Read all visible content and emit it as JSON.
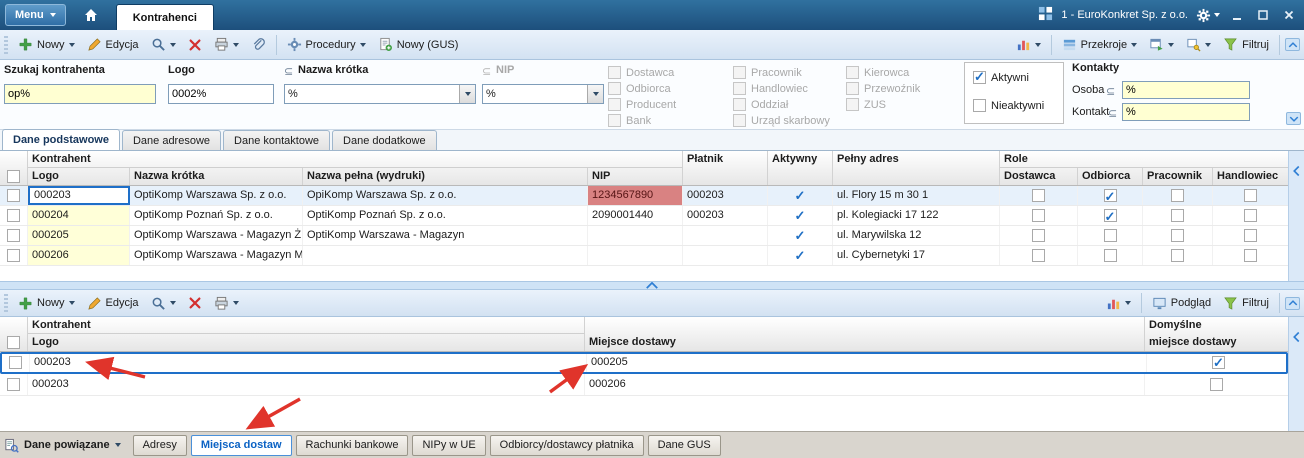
{
  "titlebar": {
    "menu": "Menu",
    "tab": "Kontrahenci",
    "company": "1 - EuroKonkret Sp. z o.o."
  },
  "toolbar1": {
    "nowy": "Nowy",
    "edycja": "Edycja",
    "procedury": "Procedury",
    "nowy_gus": "Nowy (GUS)",
    "przekroje": "Przekroje",
    "filtruj": "Filtruj"
  },
  "filters": {
    "szukaj": {
      "label": "Szukaj kontrahenta",
      "value": "op%"
    },
    "logo": {
      "label": "Logo",
      "value": "0002%"
    },
    "nazwa_krotka": {
      "label": "Nazwa krótka",
      "op": "⊆",
      "value": "%"
    },
    "nip": {
      "label": "NIP",
      "op": "⊆",
      "value": "%"
    },
    "role_group1": [
      "Dostawca",
      "Odbiorca",
      "Producent",
      "Bank"
    ],
    "role_group2": [
      "Pracownik",
      "Handlowiec",
      "Oddział",
      "Urząd skarbowy"
    ],
    "role_group3": [
      "Kierowca",
      "Przewoźnik",
      "ZUS"
    ],
    "aktywni": "Aktywni",
    "aktywni_checked": true,
    "nieaktywni": "Nieaktywni",
    "nieaktywni_checked": false,
    "kontakty": {
      "label": "Kontakty",
      "osoba_label": "Osoba",
      "osoba_op": "⊆",
      "osoba_value": "%",
      "kontakt_label": "Kontakt",
      "kontakt_op": "⊆",
      "kontakt_value": "%"
    }
  },
  "tabs": [
    "Dane podstawowe",
    "Dane adresowe",
    "Dane kontaktowe",
    "Dane dodatkowe"
  ],
  "grid1": {
    "groups": {
      "kontrahent": "Kontrahent",
      "role": "Role"
    },
    "headers": {
      "logo": "Logo",
      "nazwa_krotka": "Nazwa krótka",
      "nazwa_pelna": "Nazwa pełna (wydruki)",
      "nip": "NIP",
      "platnik": "Płatnik",
      "aktywny": "Aktywny",
      "pelny_adres": "Pełny adres",
      "dostawca": "Dostawca",
      "odbiorca": "Odbiorca",
      "pracownik": "Pracownik",
      "handlowiec": "Handlowiec"
    },
    "rows": [
      {
        "logo": "000203",
        "nazwa_krotka": "OptiKomp Warszawa Sp. z o.o.",
        "nazwa_pelna": "OpiKomp Warszawa Sp. z o.o.",
        "nip": "1234567890",
        "nip_invalid": true,
        "platnik": "000203",
        "aktywny": true,
        "pelny_adres": "ul. Flory 15 m 30 1",
        "dostawca": false,
        "odbiorca": true,
        "pracownik": false,
        "handlowiec": false
      },
      {
        "logo": "000204",
        "nazwa_krotka": "OptiKomp Poznań Sp. z o.o.",
        "nazwa_pelna": "OptiKomp Poznań Sp. z o.o.",
        "nip": "2090001440",
        "nip_invalid": false,
        "platnik": "000203",
        "aktywny": true,
        "pelny_adres": "pl. Kolegiacki 17 122",
        "dostawca": false,
        "odbiorca": true,
        "pracownik": false,
        "handlowiec": false
      },
      {
        "logo": "000205",
        "nazwa_krotka": "OptiKomp Warszawa - Magazyn Ż",
        "nazwa_pelna": "OptiKomp Warszawa - Magazyn",
        "nip": "",
        "nip_invalid": false,
        "platnik": "",
        "aktywny": true,
        "pelny_adres": "ul. Marywilska 12",
        "dostawca": false,
        "odbiorca": false,
        "pracownik": false,
        "handlowiec": false
      },
      {
        "logo": "000206",
        "nazwa_krotka": "OptiKomp Warszawa - Magazyn M",
        "nazwa_pelna": "",
        "nip": "",
        "nip_invalid": false,
        "platnik": "",
        "aktywny": true,
        "pelny_adres": "ul. Cybernetyki 17",
        "dostawca": false,
        "odbiorca": false,
        "pracownik": false,
        "handlowiec": false
      }
    ]
  },
  "toolbar2": {
    "nowy": "Nowy",
    "edycja": "Edycja",
    "podglad": "Podgląd",
    "filtruj": "Filtruj"
  },
  "grid2": {
    "group_kontrahent": "Kontrahent",
    "headers": {
      "logo": "Logo",
      "miejsce": "Miejsce dostawy",
      "domyslne_line1": "Domyślne",
      "domyslne_line2": "miejsce dostawy"
    },
    "rows": [
      {
        "logo": "000203",
        "miejsce": "000205",
        "domyslne": true
      },
      {
        "logo": "000203",
        "miejsce": "000206",
        "domyslne": false
      }
    ]
  },
  "bottom": {
    "dane_powiazane": "Dane powiązane",
    "tabs": [
      "Adresy",
      "Miejsca dostaw",
      "Rachunki bankowe",
      "NIPy w UE",
      "Odbiorcy/dostawcy płatnika",
      "Dane GUS"
    ],
    "active_tab": "Miejsca dostaw"
  },
  "colors": {
    "accent_blue": "#2f7fd4",
    "invalid_nip_bg": "#d98282",
    "filter_input_bg": "#ffffd2",
    "check_blue": "#1f6fc4",
    "arrow_red": "#e0342b"
  }
}
